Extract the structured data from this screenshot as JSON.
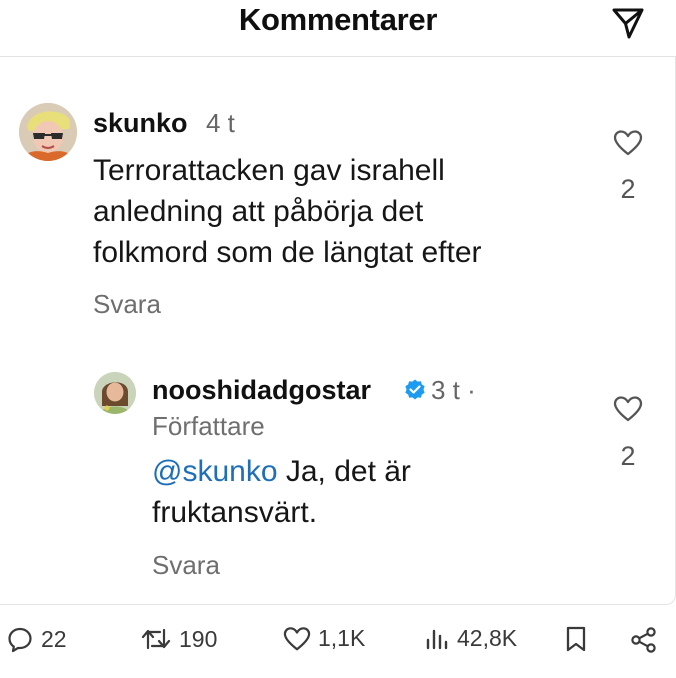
{
  "header": {
    "title": "Kommentarer"
  },
  "comments": [
    {
      "username": "skunko",
      "time": "4 t",
      "text_lines": [
        "Terrorattacken gav israhell",
        "anledning att påbörja det",
        "folkmord som de längtat efter"
      ],
      "reply_label": "Svara",
      "likes": "2"
    }
  ],
  "reply": {
    "username": "nooshidadgostar",
    "time": "3 t ·",
    "author_tag": "Författare",
    "mention": "@skunko",
    "text_after_mention": " Ja, det är",
    "text_line2": "fruktansvärt.",
    "reply_label": "Svara",
    "likes": "2",
    "verified_color": "#1d9bf0"
  },
  "stats": {
    "replies": "22",
    "retweets": "190",
    "likes": "1,1K",
    "views": "42,8K"
  },
  "icons": [
    "send-icon",
    "heart-icon",
    "verified-icon",
    "reply-icon",
    "retweet-icon",
    "views-icon",
    "bookmark-icon",
    "share-icon"
  ]
}
